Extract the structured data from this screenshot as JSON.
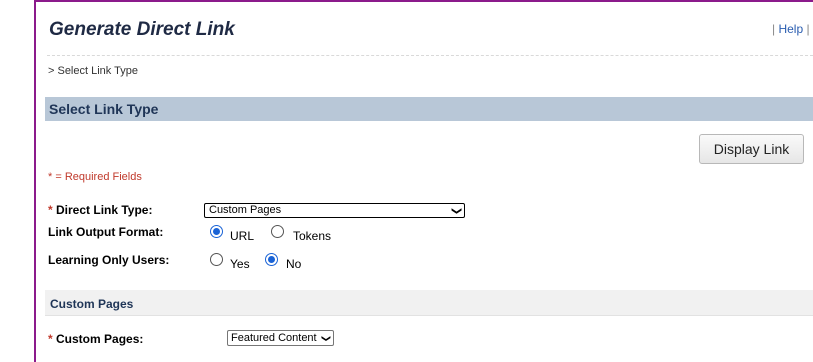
{
  "page": {
    "title": "Generate Direct Link",
    "help_link": "Help",
    "breadcrumb": "> Select Link Type"
  },
  "section": {
    "title": "Select Link Type",
    "display_link_button": "Display Link",
    "required_note": "* = Required Fields"
  },
  "fields": {
    "direct_link_type": {
      "required_marker": "*",
      "label": "Direct Link Type:",
      "value": "Custom Pages"
    },
    "link_output_format": {
      "label": "Link Output Format:",
      "options": [
        {
          "label": "URL",
          "checked": true
        },
        {
          "label": "Tokens",
          "checked": false
        }
      ]
    },
    "learning_only_users": {
      "label": "Learning Only Users:",
      "options": [
        {
          "label": "Yes",
          "checked": false
        },
        {
          "label": "No",
          "checked": true
        }
      ]
    }
  },
  "custom_pages_section": {
    "title": "Custom Pages",
    "field": {
      "required_marker": "*",
      "label": "Custom Pages:",
      "value": "Featured Content"
    }
  },
  "colors": {
    "frame_border": "#8b1a8b",
    "section_bar": "#b8c7d7",
    "required_red": "#c0392b",
    "radio_blue": "#1a63d6",
    "title_navy": "#1f2a44"
  },
  "icons": {
    "select_chevron": "chevron-down-icon"
  }
}
